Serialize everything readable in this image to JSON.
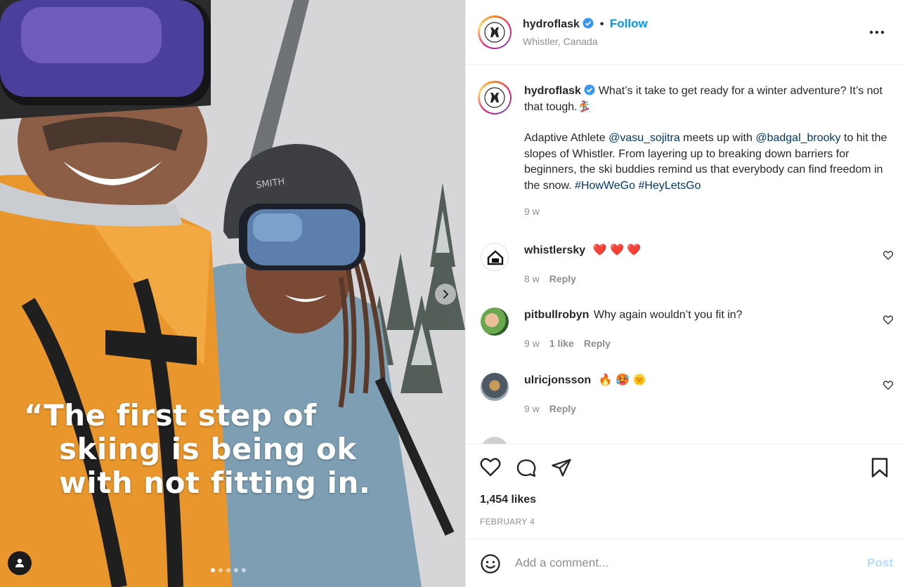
{
  "post": {
    "username": "hydroflask",
    "follow_label": "Follow",
    "location": "Whistler, Canada",
    "overlay_quote_line1": "“The first step of",
    "overlay_quote_line2": "skiing is being ok",
    "overlay_quote_line3": "with not fitting in.",
    "carousel_count": 5,
    "carousel_active": 1
  },
  "caption": {
    "username": "hydroflask",
    "text_1": "What’s it take to get ready for a winter adventure? It’s not that tough.",
    "emoji_1": "🏂",
    "text_2a": "Adaptive Athlete ",
    "mention_1": "@vasu_sojitra",
    "text_2b": " meets up with ",
    "mention_2": "@badgal_brooky",
    "text_2c": " to hit the slopes of Whistler. From layering up to breaking down barriers for beginners, the ski buddies remind us that everybody can find freedom in the snow. ",
    "hashtag_1": "#HowWeGo",
    "hashtag_2": "#HeyLetsGo",
    "time": "9 w"
  },
  "comments": [
    {
      "username": "whistlersky",
      "text": "❤️ ❤️ ❤️",
      "time": "8 w",
      "likes": "",
      "reply": "Reply"
    },
    {
      "username": "pitbullrobyn",
      "text": "Why again wouldn’t you fit in?",
      "time": "9 w",
      "likes": "1 like",
      "reply": "Reply"
    },
    {
      "username": "ulricjonsson",
      "text": "🔥 🥵 🌞",
      "time": "9 w",
      "likes": "",
      "reply": "Reply"
    }
  ],
  "stats": {
    "likes": "1,454 likes",
    "date": "FEBRUARY 4"
  },
  "add_comment": {
    "placeholder": "Add a comment...",
    "post_label": "Post"
  },
  "colors": {
    "link": "#00376b",
    "follow": "#0095f6",
    "verified": "#3897f0",
    "heart": "#ed4956",
    "post_disabled": "#b2dffc",
    "secondary_text": "#8e8e8e"
  }
}
